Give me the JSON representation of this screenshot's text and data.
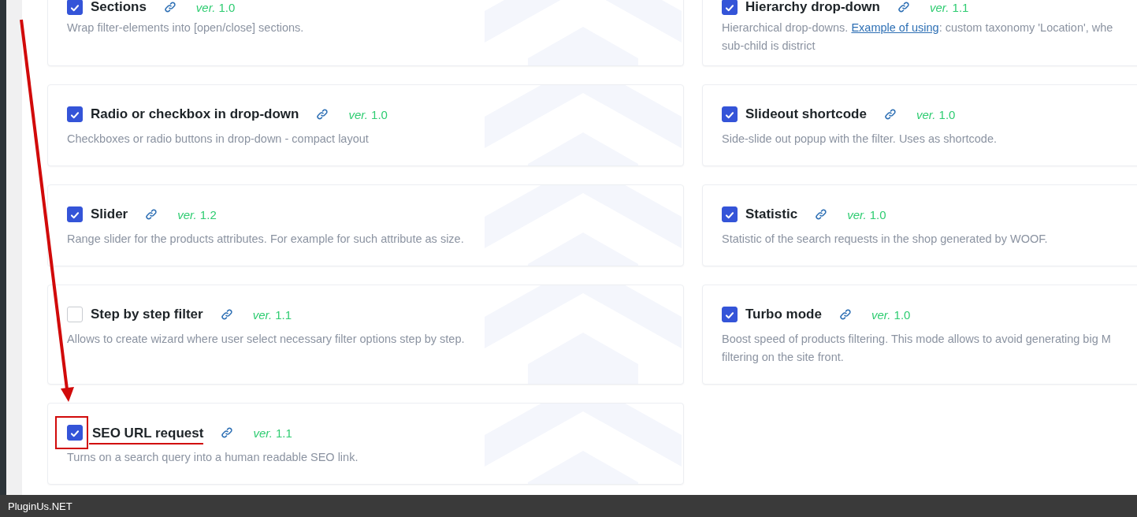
{
  "cards": [
    {
      "title": "Sections",
      "checked": true,
      "version": "*ver.* 1.0",
      "highlighted": false,
      "lines": [
        [
          {
            "kind": "text",
            "text": "Wrap filter-elements into [open/close] sections."
          }
        ]
      ]
    },
    {
      "title": "Hierarchy drop-down",
      "checked": true,
      "version": "*ver.* 1.1",
      "highlighted": false,
      "lines": [
        [
          {
            "kind": "text",
            "text": "Hierarchical drop-downs. "
          },
          {
            "kind": "link",
            "text": "Example of using"
          },
          {
            "kind": "text",
            "text": ": custom taxonomy 'Location', whe"
          }
        ],
        [
          {
            "kind": "text",
            "text": "sub-child is district"
          }
        ]
      ]
    },
    {
      "title": "Radio or checkbox in drop-down",
      "checked": true,
      "version": "*ver.* 1.0",
      "highlighted": false,
      "lines": [
        [
          {
            "kind": "text",
            "text": "Checkboxes or radio buttons in drop-down - compact layout"
          }
        ]
      ]
    },
    {
      "title": "Slideout shortcode",
      "checked": true,
      "version": "*ver.* 1.0",
      "highlighted": false,
      "lines": [
        [
          {
            "kind": "text",
            "text": "Side-slide out popup with the filter. Uses as shortcode."
          }
        ]
      ]
    },
    {
      "title": "Slider",
      "checked": true,
      "version": "*ver.* 1.2",
      "highlighted": false,
      "lines": [
        [
          {
            "kind": "text",
            "text": "Range slider for the products attributes. For example for such attribute as size."
          }
        ]
      ]
    },
    {
      "title": "Statistic",
      "checked": true,
      "version": "*ver.* 1.0",
      "highlighted": false,
      "lines": [
        [
          {
            "kind": "text",
            "text": "Statistic of the search requests in the shop generated by WOOF."
          }
        ]
      ]
    },
    {
      "title": "Step by step filter",
      "checked": false,
      "version": "*ver.* 1.1",
      "highlighted": false,
      "lines": [
        [
          {
            "kind": "text",
            "text": "Allows to create wizard where user select necessary filter options step by step."
          }
        ]
      ]
    },
    {
      "title": "Turbo mode",
      "checked": true,
      "version": "*ver.* 1.0",
      "highlighted": false,
      "lines": [
        [
          {
            "kind": "text",
            "text": "Boost speed of products filtering. This mode allows to avoid generating big M"
          }
        ],
        [
          {
            "kind": "text",
            "text": "filtering on the site front."
          }
        ]
      ]
    },
    {
      "title": "SEO URL request",
      "checked": true,
      "version": "*ver.* 1.1",
      "highlighted": true,
      "lines": [
        [
          {
            "kind": "text",
            "text": "Turns on a search query into a human readable SEO link."
          }
        ]
      ]
    }
  ],
  "footer": {
    "text": "PluginUs.NET"
  }
}
